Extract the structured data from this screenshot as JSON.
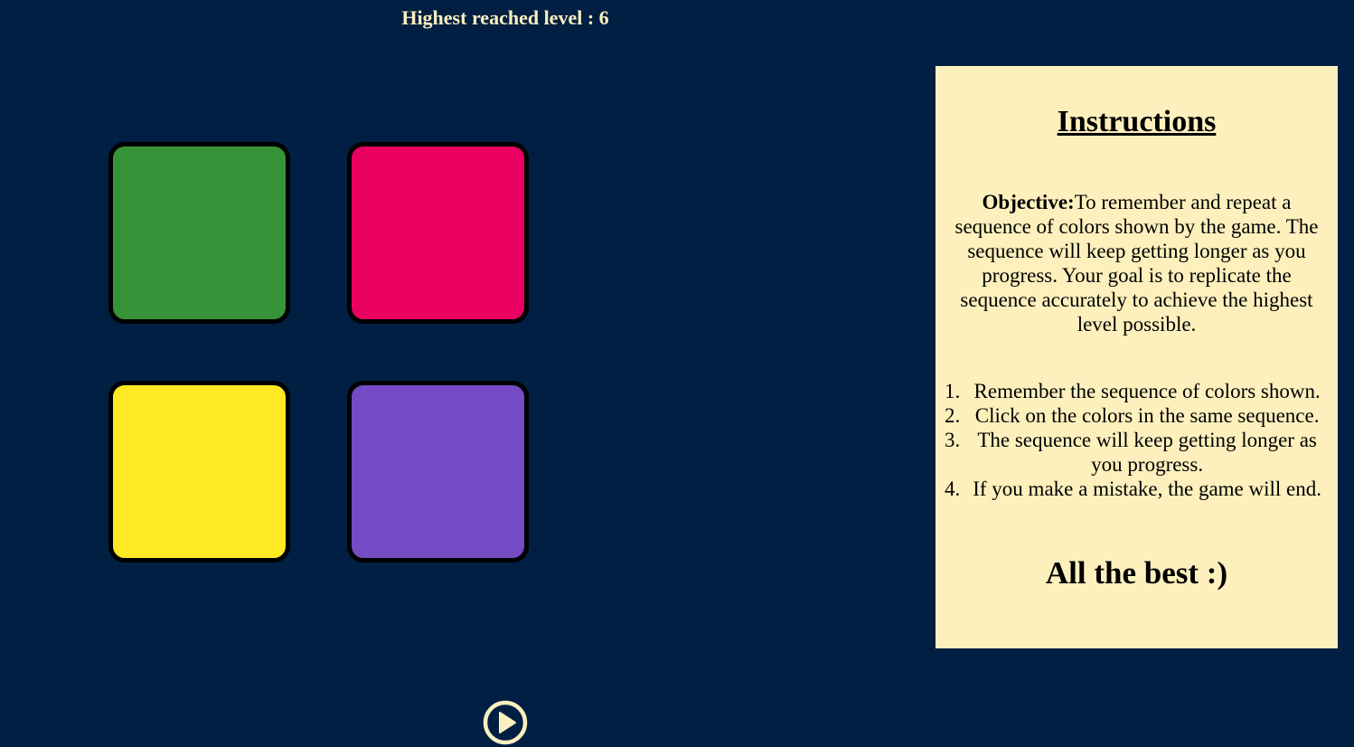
{
  "status": {
    "highest_level_text": "Highest reached level : 6"
  },
  "board": {
    "pads": [
      {
        "name": "green",
        "color": "#379337"
      },
      {
        "name": "red",
        "color": "#ea0060"
      },
      {
        "name": "yellow",
        "color": "#ffe923"
      },
      {
        "name": "purple",
        "color": "#744bc5"
      }
    ]
  },
  "controls": {
    "play_icon": "play-circle-icon",
    "accent_color": "#fbefc0"
  },
  "instructions": {
    "title": "Instructions",
    "objective_label": "Objective:",
    "objective_text": "To remember and repeat a sequence of colors shown by the game. The sequence will keep getting longer as you progress. Your goal is to replicate the sequence accurately to achieve the highest level possible.",
    "steps": [
      {
        "num": "1.",
        "text": "Remember the sequence of colors shown."
      },
      {
        "num": "2.",
        "text": "Click on the colors in the same sequence."
      },
      {
        "num": "3.",
        "text": "The sequence will keep getting longer as you progress."
      },
      {
        "num": "4.",
        "text": "If you make a mistake, the game will end."
      }
    ],
    "closing": "All the best :)"
  }
}
